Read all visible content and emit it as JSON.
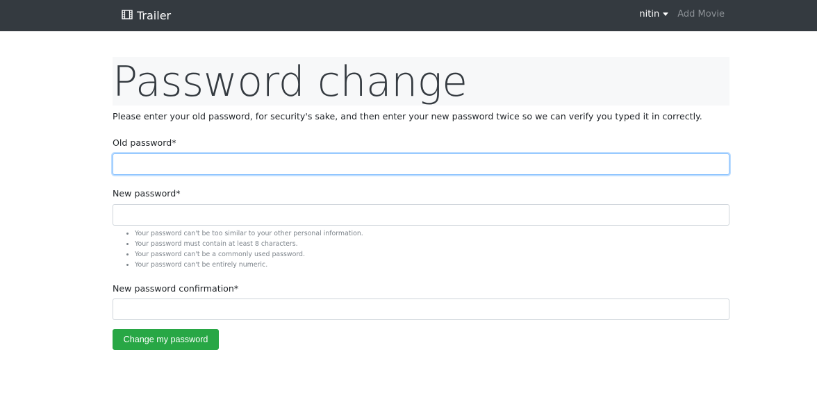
{
  "navbar": {
    "brand_icon": "film-icon",
    "brand_label": "Trailer",
    "user_label": "nitin",
    "add_movie_label": "Add Movie"
  },
  "page": {
    "title": "Password change",
    "intro": "Please enter your old password, for security's sake, and then enter your new password twice so we can verify you typed it in correctly."
  },
  "form": {
    "old_password_label": "Old password*",
    "new_password_label": "New password*",
    "confirm_label": "New password confirmation*",
    "help_items": [
      "Your password can't be too similar to your other personal information.",
      "Your password must contain at least 8 characters.",
      "Your password can't be a commonly used password.",
      "Your password can't be entirely numeric."
    ],
    "submit_label": "Change my password"
  },
  "colors": {
    "navbar": "#343a40",
    "primary_button": "#28a745",
    "focus_border": "#80bdff"
  }
}
